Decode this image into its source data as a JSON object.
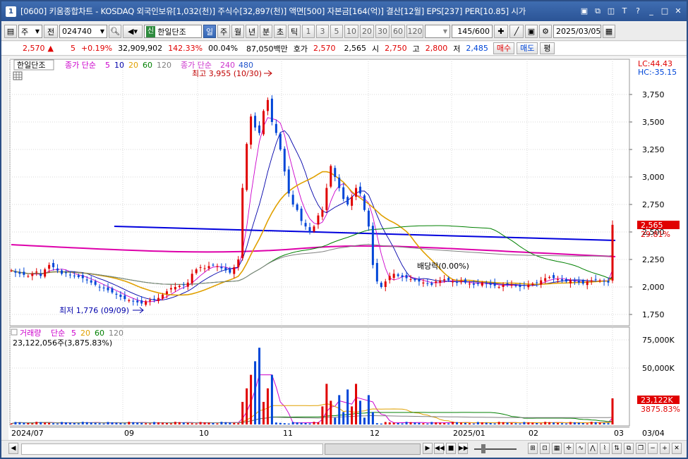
{
  "window": {
    "number": "1",
    "title": "[0600] 키움종합차트 - KOSDAQ 외국인보유[1,032(천)] 주식수[32,897(천)] 액면[500] 자본금[164(억)] 결산[12월] EPS[237] PER[10.85] 시가"
  },
  "toolbar": {
    "type_label": "주",
    "prev_label": "전",
    "code": "024740",
    "stock_badge": "신",
    "stock_name": "한일단조",
    "periods": [
      "일",
      "주",
      "월",
      "년",
      "분",
      "초",
      "틱"
    ],
    "active_period": "일",
    "intervals": [
      "1",
      "3",
      "5",
      "10",
      "20",
      "30",
      "60",
      "120"
    ],
    "count": "145",
    "count_max": "/600",
    "date": "2025/03/05"
  },
  "quote": {
    "price": "2,570",
    "arrow": "▲",
    "change": "5",
    "change_rate": "+0.19%",
    "volume": "32,909,902",
    "volume_ratio": "142.33%",
    "turnover": "00.04%",
    "amount": "87,050백만",
    "ask_label": "호가",
    "ask": "2,570",
    "bid": "2,565",
    "open_label": "시",
    "open": "2,750",
    "high_label": "고",
    "high": "2,800",
    "low_label": "저",
    "low": "2,485",
    "buy_label": "매수",
    "sell_label": "매도",
    "avg_label": "평"
  },
  "price_legend": {
    "name": "한일단조",
    "ma_title": "종가 단순",
    "ma_periods": [
      "5",
      "10",
      "20",
      "60",
      "120"
    ],
    "ma2_title": "종가 단순",
    "ma2_periods": [
      "240",
      "480"
    ],
    "ma_colors": [
      "#cc00cc",
      "#0000aa",
      "#e0a000",
      "#008000",
      "#808080"
    ],
    "ma2_colors": [
      "#cc33cc",
      "#2255cc"
    ]
  },
  "price_right": {
    "lc": "LC:44.43",
    "hc": "HC:-35.15",
    "last_price": "2,565",
    "last_pct": "29.81%"
  },
  "annotations": {
    "high": "최고 3,955 (10/30)",
    "low": "최저 1,776 (09/09)",
    "dividend": "배당락(0.00%)"
  },
  "price_axis": [
    "3,750",
    "3,500",
    "3,250",
    "3,000",
    "2,750",
    "2,500",
    "2,250",
    "2,000",
    "1,750"
  ],
  "volume_legend": {
    "title": "거래량",
    "ma_title": "단순",
    "ma_periods": [
      "5",
      "20",
      "60",
      "120"
    ],
    "ma_colors": [
      "#cc00cc",
      "#e0a000",
      "#008000",
      "#808080"
    ],
    "value": "23,122,056주(3,875.83%)"
  },
  "volume_axis": [
    "75,000K",
    "50,000K"
  ],
  "volume_right": {
    "last": "23,122K",
    "pct": "3875.83%"
  },
  "date_axis": [
    "2024/07",
    "09",
    "10",
    "11",
    "12",
    "2025/01",
    "02",
    "03"
  ],
  "date_axis_right": "03/04",
  "colors": {
    "up": "#e00000",
    "down": "#0046d8",
    "trend_line": "#0000dd",
    "trend_line2": "#dd00aa"
  }
}
